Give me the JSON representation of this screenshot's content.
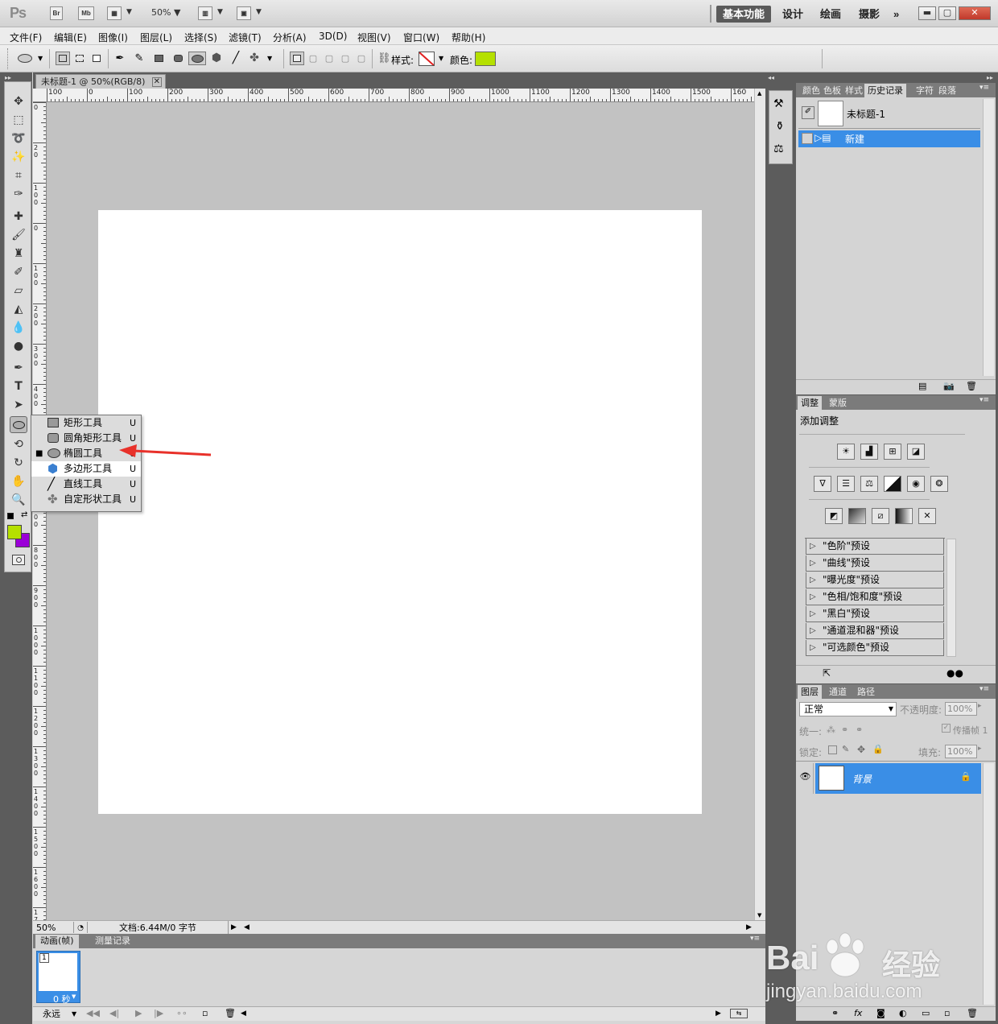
{
  "app": {
    "logo": "Ps",
    "bridge": "Br",
    "minibridge": "Mb",
    "zoom": "50%",
    "workspaces": [
      "基本功能",
      "设计",
      "绘画",
      "摄影"
    ],
    "more": "»"
  },
  "menu": [
    "文件(F)",
    "编辑(E)",
    "图像(I)",
    "图层(L)",
    "选择(S)",
    "滤镜(T)",
    "分析(A)",
    "3D(D)",
    "视图(V)",
    "窗口(W)",
    "帮助(H)"
  ],
  "options": {
    "style_label": "样式:",
    "color_label": "颜色:",
    "color_value": "#b5e000"
  },
  "document": {
    "tab_title": "未标题-1 @ 50%(RGB/8)",
    "ruler_h": [
      "100",
      "0",
      "100",
      "200",
      "300",
      "400",
      "500",
      "600",
      "700",
      "800",
      "900",
      "1000",
      "1100",
      "1200",
      "1300",
      "1400",
      "1500",
      "160"
    ],
    "ruler_v": [
      "0",
      "2 0",
      "1 0 0",
      "0",
      "1 0 0",
      "2 0 0",
      "3 0 0",
      "4 0 0",
      "5 0 0",
      "6 0 0",
      "7 0 0",
      "8 0 0",
      "9 0 0",
      "1 0 0 0",
      "1 1 0 0",
      "1 2 0 0",
      "1 3 0 0",
      "1 4 0 0",
      "1 5 0 0",
      "1 6 0 0",
      "1 7 0 0"
    ],
    "status_zoom": "50%",
    "status_doc": "文档:6.44M/0 字节"
  },
  "tool_flyout": [
    {
      "label": "矩形工具",
      "key": "U",
      "icon": "rectangle-icon",
      "selected": false
    },
    {
      "label": "圆角矩形工具",
      "key": "U",
      "icon": "rounded-rectangle-icon",
      "selected": false
    },
    {
      "label": "椭圆工具",
      "key": "U",
      "icon": "ellipse-icon",
      "selected": true
    },
    {
      "label": "多边形工具",
      "key": "U",
      "icon": "polygon-icon",
      "selected": false
    },
    {
      "label": "直线工具",
      "key": "U",
      "icon": "line-icon",
      "selected": false
    },
    {
      "label": "自定形状工具",
      "key": "U",
      "icon": "custom-shape-icon",
      "selected": false
    }
  ],
  "colors": {
    "foreground": "#b5e000",
    "background": "#9b00d8",
    "accent": "#3a8ee6",
    "arrow": "#e8312a"
  },
  "history_panel": {
    "tabs": [
      "颜色",
      "色板",
      "样式",
      "历史记录",
      "字符",
      "段落"
    ],
    "snapshot": "未标题-1",
    "items": [
      "新建"
    ]
  },
  "adjustments_panel": {
    "tabs": [
      "调整",
      "蒙版"
    ],
    "title": "添加调整",
    "presets": [
      "\"色阶\"预设",
      "\"曲线\"预设",
      "\"曝光度\"预设",
      "\"色相/饱和度\"预设",
      "\"黑白\"预设",
      "\"通道混和器\"预设",
      "\"可选颜色\"预设"
    ]
  },
  "layers_panel": {
    "tabs": [
      "图层",
      "通道",
      "路径"
    ],
    "blend_mode": "正常",
    "opacity_label": "不透明度:",
    "opacity": "100%",
    "unify_label": "统一:",
    "propagate_label": "传播帧 1",
    "lock_label": "锁定:",
    "fill_label": "填充:",
    "fill": "100%",
    "layer_name": "背景"
  },
  "animation_panel": {
    "tabs": [
      "动画(帧)",
      "测量记录"
    ],
    "frame_number": "1",
    "frame_delay": "0 秒",
    "loop": "永远"
  },
  "watermark": {
    "brand": "Bai",
    "brand2": "经验",
    "url": "jingyan.baidu.com"
  }
}
